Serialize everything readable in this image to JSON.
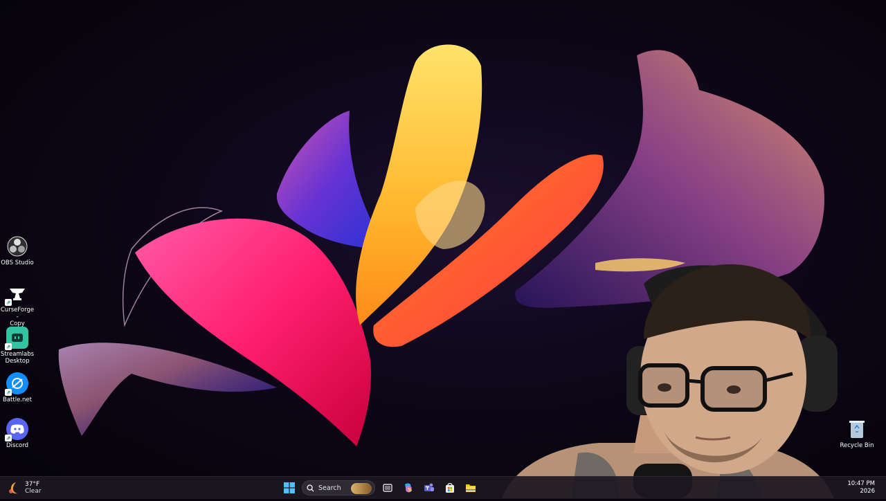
{
  "desktop": {
    "icons": [
      {
        "label": "OBS Studio",
        "icon": "obs-icon"
      },
      {
        "label": "CurseForge -\nCopy",
        "icon": "curseforge-icon"
      },
      {
        "label": "Streamlabs\nDesktop",
        "icon": "streamlabs-icon"
      },
      {
        "label": "Battle.net",
        "icon": "battlenet-icon"
      },
      {
        "label": "Discord",
        "icon": "discord-icon"
      },
      {
        "label": "Recycle Bin",
        "icon": "recycle-bin-icon"
      }
    ]
  },
  "taskbar": {
    "weather": {
      "temp": "37°F",
      "condition": "Clear"
    },
    "search": {
      "placeholder": "Search"
    },
    "clock": {
      "time": "10:47 PM",
      "date": "2026"
    },
    "pinned": [
      "start-icon",
      "search-icon",
      "task-view-icon",
      "copilot-icon",
      "teams-icon",
      "store-icon",
      "file-explorer-icon"
    ]
  },
  "colors": {
    "taskbar_bg": "#1c1822",
    "accent_pink": "#ff2f7a",
    "accent_orange": "#ff8a1f",
    "accent_yellow": "#ffc53a"
  }
}
